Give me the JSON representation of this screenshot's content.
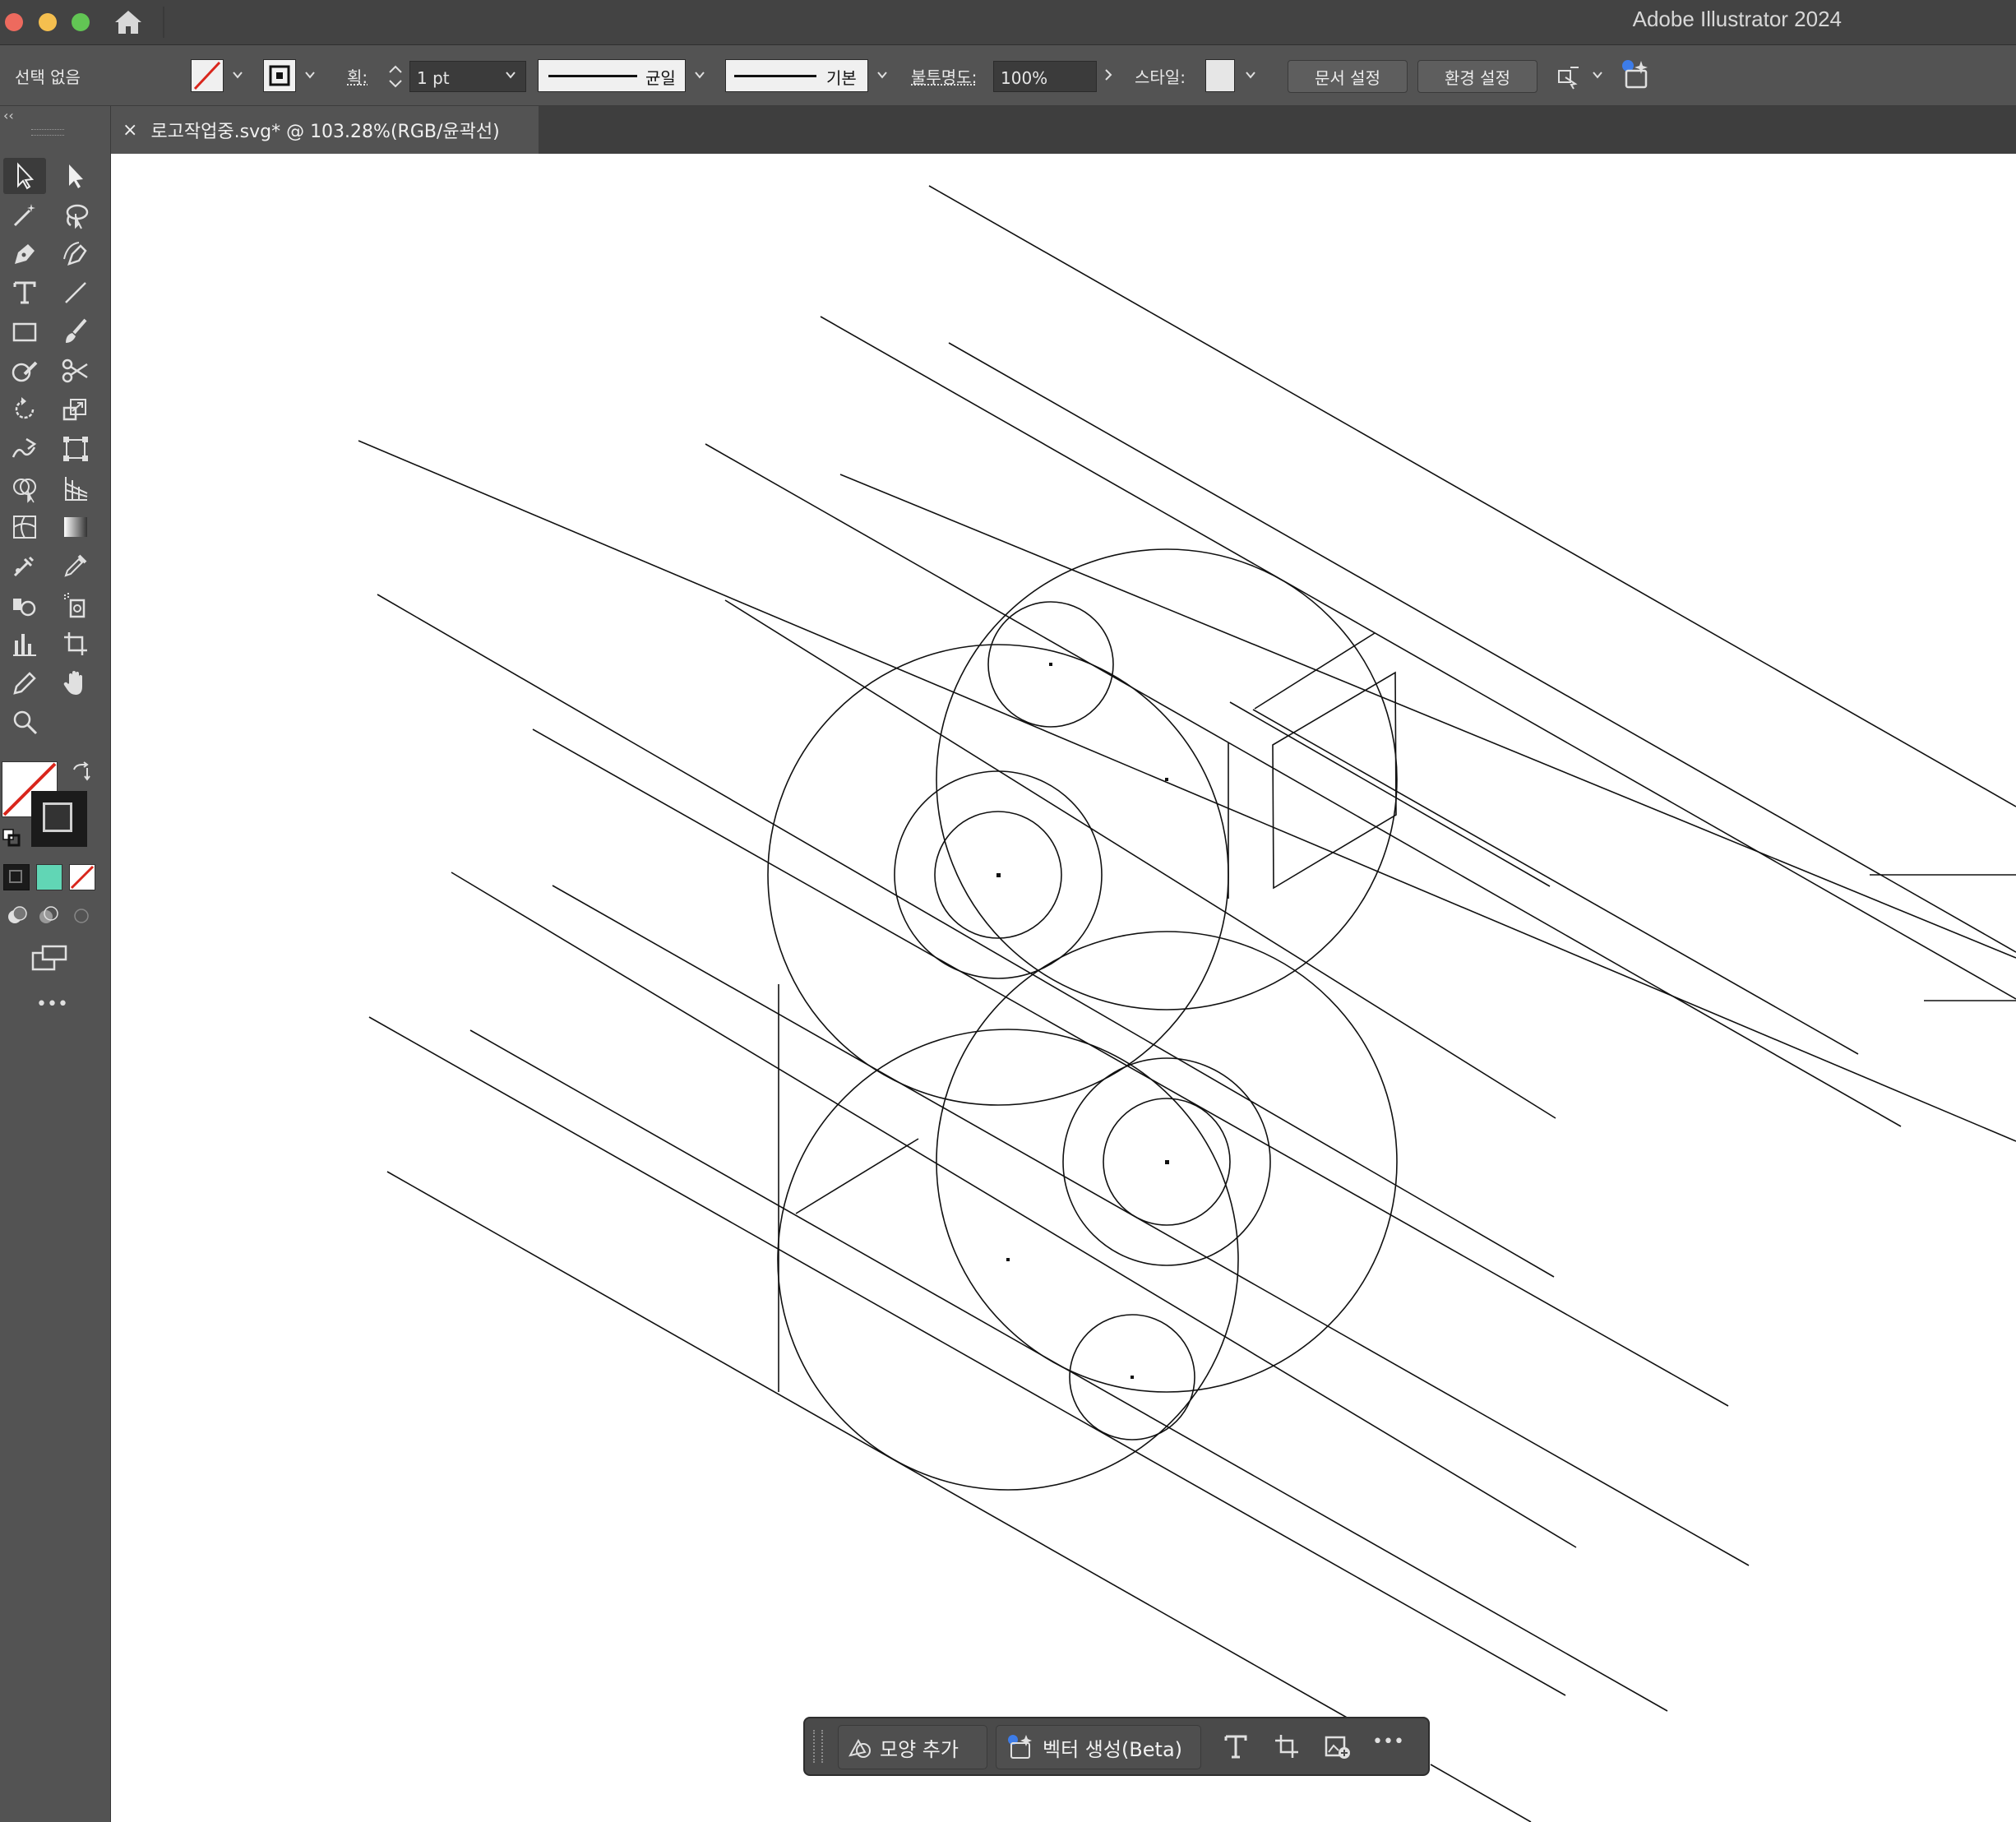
{
  "app": {
    "title": "Adobe Illustrator 2024"
  },
  "control_bar": {
    "selection_status": "선택 없음",
    "stroke_label": "획:",
    "stroke_weight": "1 pt",
    "stroke_profile": "균일",
    "brush": "기본",
    "opacity_label": "불투명도:",
    "opacity_value": "100%",
    "style_label": "스타일:",
    "document_setup": "문서 설정",
    "preferences": "환경 설정"
  },
  "document_tab": {
    "close": "×",
    "title": "로고작업중.svg* @ 103.28%(RGB/윤곽선)"
  },
  "tools_panel": {
    "collapse": "‹‹",
    "more": "•••"
  },
  "colors": {
    "swatch_mode_color": "#61d6b5",
    "none_red": "#d9261c",
    "panel_bg": "#535353",
    "canvas_bg": "#ffffff"
  },
  "contextual_bar": {
    "add_shape": "모양 추가",
    "generate_vector": "벡터 생성(Beta)",
    "more": "•••"
  }
}
